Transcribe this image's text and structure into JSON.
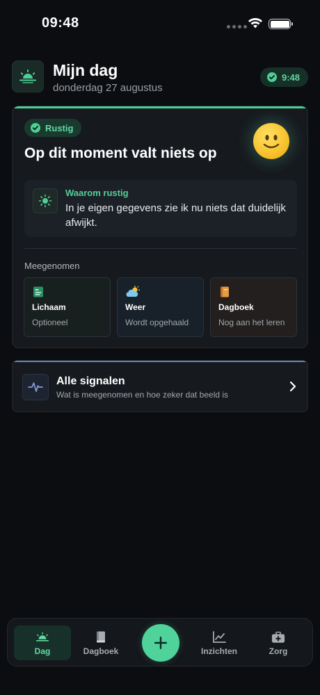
{
  "status_bar": {
    "time": "09:48"
  },
  "header": {
    "title": "Mijn dag",
    "date": "donderdag 27 augustus",
    "time_badge": "9:48",
    "icon": "sunrise-icon"
  },
  "main_card": {
    "status_badge": "Rustig",
    "title": "Op dit moment valt niets op",
    "emoji": "slightly-smiling-face-icon",
    "accent_color": "#4ecf96",
    "reason": {
      "heading": "Waarom rustig",
      "text": "In je eigen gegevens zie ik nu niets dat duidelijk afwijkt.",
      "icon": "sun-icon"
    },
    "sources_label": "Meegenomen",
    "sources": [
      {
        "title": "Lichaam",
        "subtitle": "Optioneel",
        "icon": "id-card-icon",
        "color": "#4ecf96"
      },
      {
        "title": "Weer",
        "subtitle": "Wordt opgehaald",
        "icon": "sun-behind-cloud-icon",
        "color": "#6fc0e8"
      },
      {
        "title": "Dagboek",
        "subtitle": "Nog aan het leren",
        "icon": "book-icon",
        "color": "#e8a04a"
      }
    ]
  },
  "signals_card": {
    "title": "Alle signalen",
    "subtitle": "Wat is meegenomen en hoe zeker dat beeld is",
    "icon": "pulse-icon",
    "accent_color": "#6f7fb6"
  },
  "tab_bar": {
    "tabs": [
      {
        "label": "Dag",
        "icon": "sunrise-icon",
        "active": true
      },
      {
        "label": "Dagboek",
        "icon": "book-icon",
        "active": false
      },
      {
        "label": "Inzichten",
        "icon": "chart-icon",
        "active": false
      },
      {
        "label": "Zorg",
        "icon": "medical-bag-icon",
        "active": false
      }
    ],
    "fab_icon": "plus-icon"
  }
}
